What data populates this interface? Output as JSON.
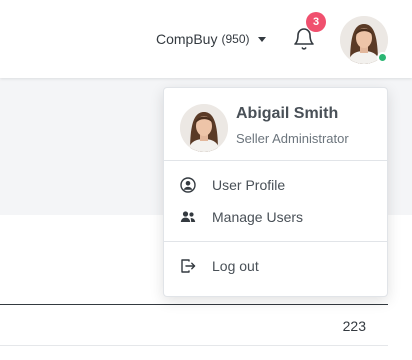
{
  "navbar": {
    "company": {
      "name": "CompBuy",
      "count": "(950)"
    },
    "notifications": {
      "count": "3",
      "badge_color": "#f0506e"
    },
    "user_avatar": {
      "status": "online",
      "status_color": "#2bb673"
    }
  },
  "dropdown": {
    "user": {
      "name": "Abigail Smith",
      "role": "Seller Administrator"
    },
    "items": [
      {
        "label": "User Profile",
        "icon": "user-circle-icon"
      },
      {
        "label": "Manage Users",
        "icon": "users-icon"
      }
    ],
    "logout": {
      "label": "Log out",
      "icon": "logout-icon"
    }
  },
  "table": {
    "visible_value": "223"
  }
}
